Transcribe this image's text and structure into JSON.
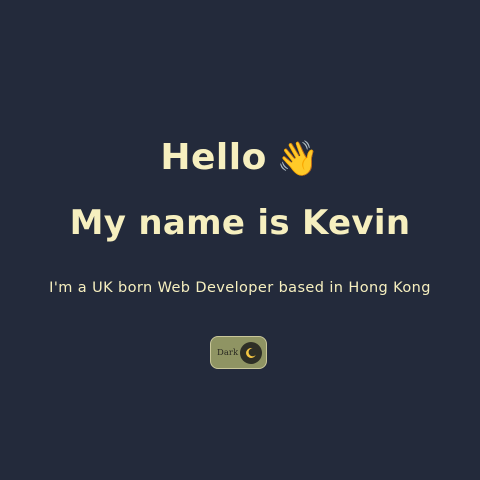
{
  "hero": {
    "greeting": "Hello",
    "wave_icon": "👋",
    "name_line": "My name is Kevin",
    "tagline": "I'm a UK born Web Developer based in Hong Kong"
  },
  "theme_toggle": {
    "label": "Dark",
    "icon": "moon-icon"
  },
  "colors": {
    "background": "#232a3b",
    "text": "#f6efbf",
    "toggle_bg": "#8f9463"
  }
}
